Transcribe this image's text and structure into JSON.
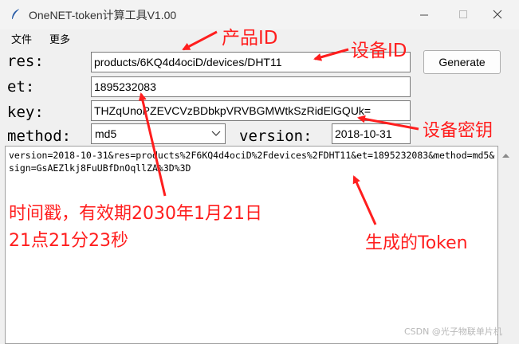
{
  "window": {
    "title": "OneNET-token计算工具V1.00"
  },
  "menu": [
    "文件",
    "更多"
  ],
  "fields": {
    "res": {
      "label": "res:",
      "value": "products/6KQ4d4ociD/devices/DHT11"
    },
    "et": {
      "label": "et:",
      "value": "1895232083"
    },
    "key": {
      "label": "key:",
      "value": "THZqUnoPZEVCVzBDbkpVRVBGMWtkSzRidElGQUk="
    },
    "method": {
      "label": "method:",
      "value": "md5"
    },
    "version": {
      "label": "version:",
      "value": "2018-10-31"
    }
  },
  "generate_label": "Generate",
  "output": {
    "text": "version=2018-10-31&res=products%2F6KQ4d4ociD%2Fdevices%2FDHT11&et=1895232083&method=md5&sign=GsAEZlkj8FuUBfDnOqllZA%3D%3D"
  },
  "annotations": {
    "product_id": "产品ID",
    "device_id": "设备ID",
    "device_key": "设备密钥",
    "timestamp_line1": "时间戳，有效期2030年1月21日",
    "timestamp_line2": "21点21分23秒",
    "token": "生成的Token"
  },
  "watermark": "CSDN @光子物联单片机",
  "colors": {
    "annotation": "#ff1e1e",
    "window_bg": "#f0f0f0"
  }
}
